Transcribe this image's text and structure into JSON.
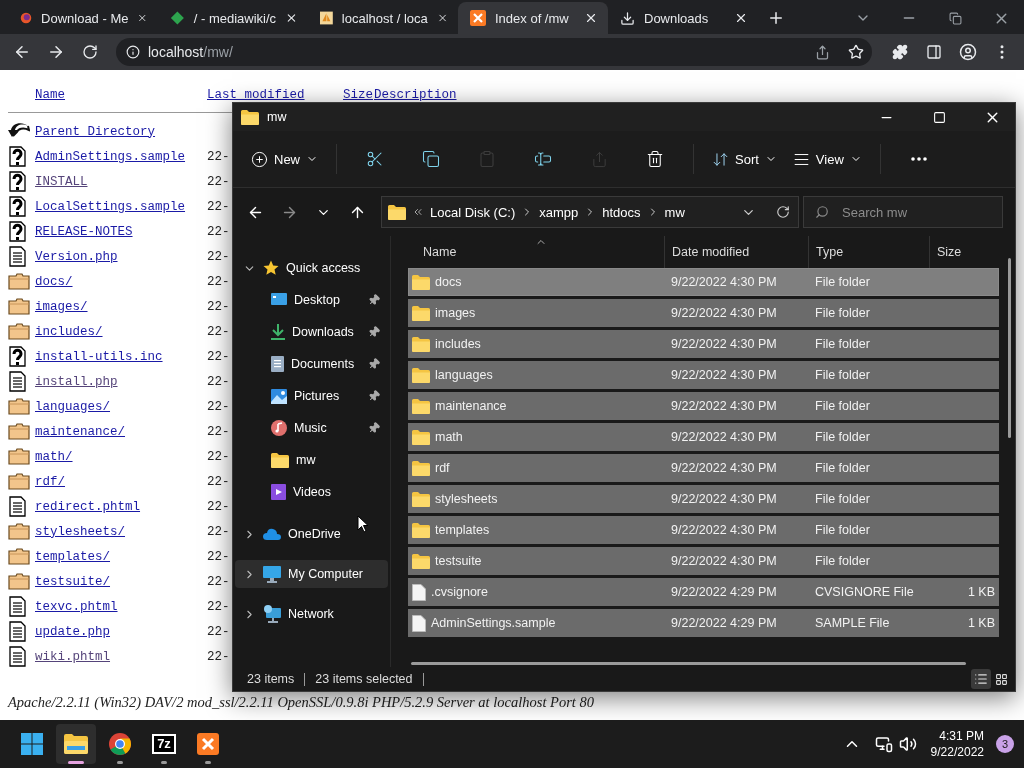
{
  "browser": {
    "tabs": [
      {
        "title": "Download - Me",
        "selected": false
      },
      {
        "title": "/ - mediawiki/c",
        "selected": false
      },
      {
        "title": "localhost / loca",
        "selected": false
      },
      {
        "title": "Index of /mw",
        "selected": true
      },
      {
        "title": "Downloads",
        "selected": false
      }
    ],
    "address": {
      "host": "localhost",
      "path": "/mw/"
    }
  },
  "listing": {
    "columns": [
      "Name",
      "Last modified",
      "Size",
      "Description"
    ],
    "rows": [
      {
        "kind": "parent",
        "name": "Parent Directory",
        "visited": false
      },
      {
        "kind": "unknown",
        "name": "AdminSettings.sample",
        "date": "22-",
        "visited": false
      },
      {
        "kind": "unknown",
        "name": "INSTALL",
        "date": "22-",
        "visited": true
      },
      {
        "kind": "unknown",
        "name": "LocalSettings.sample",
        "date": "22-",
        "visited": false
      },
      {
        "kind": "unknown",
        "name": "RELEASE-NOTES",
        "date": "22-",
        "visited": false
      },
      {
        "kind": "text",
        "name": "Version.php",
        "date": "22-",
        "visited": false
      },
      {
        "kind": "folder",
        "name": "docs/",
        "date": "22-",
        "visited": false
      },
      {
        "kind": "folder",
        "name": "images/",
        "date": "22-",
        "visited": false
      },
      {
        "kind": "folder",
        "name": "includes/",
        "date": "22-",
        "visited": false
      },
      {
        "kind": "unknown",
        "name": "install-utils.inc",
        "date": "22-",
        "visited": false
      },
      {
        "kind": "text",
        "name": "install.php",
        "date": "22-",
        "visited": true
      },
      {
        "kind": "folder",
        "name": "languages/",
        "date": "22-",
        "visited": false
      },
      {
        "kind": "folder",
        "name": "maintenance/",
        "date": "22-",
        "visited": false
      },
      {
        "kind": "folder",
        "name": "math/",
        "date": "22-",
        "visited": false
      },
      {
        "kind": "folder",
        "name": "rdf/",
        "date": "22-",
        "visited": false
      },
      {
        "kind": "text",
        "name": "redirect.phtml",
        "date": "22-",
        "visited": false
      },
      {
        "kind": "folder",
        "name": "stylesheets/",
        "date": "22-",
        "visited": false
      },
      {
        "kind": "folder",
        "name": "templates/",
        "date": "22-",
        "visited": false
      },
      {
        "kind": "folder",
        "name": "testsuite/",
        "date": "22-",
        "visited": false
      },
      {
        "kind": "text",
        "name": "texvc.phtml",
        "date": "22-",
        "visited": false
      },
      {
        "kind": "text",
        "name": "update.php",
        "date": "22-",
        "visited": false
      },
      {
        "kind": "text",
        "name": "wiki.phtml",
        "date": "22-",
        "visited": true
      }
    ],
    "footer": "Apache/2.2.11 (Win32) DAV/2 mod_ssl/2.2.11 OpenSSL/0.9.8i PHP/5.2.9 Server at localhost Port 80"
  },
  "explorer": {
    "title": "mw",
    "commands": [
      {
        "kind": "new",
        "label": "New",
        "disabled": false
      },
      {
        "kind": "cut",
        "disabled": false
      },
      {
        "kind": "copy",
        "disabled": false
      },
      {
        "kind": "paste",
        "disabled": true
      },
      {
        "kind": "rename",
        "disabled": false
      },
      {
        "kind": "share",
        "disabled": true
      },
      {
        "kind": "delete",
        "disabled": false
      },
      {
        "kind": "sort",
        "label": "Sort",
        "disabled": false
      },
      {
        "kind": "view",
        "label": "View",
        "disabled": false
      },
      {
        "kind": "more",
        "disabled": false
      }
    ],
    "breadcrumb": [
      "Local Disk (C:)",
      "xampp",
      "htdocs",
      "mw"
    ],
    "search": {
      "placeholder": "Search mw"
    },
    "nav": [
      {
        "label": "Quick access",
        "expanded": true,
        "selected": false,
        "children": [
          {
            "label": "Desktop",
            "pinned": true,
            "selected": false
          },
          {
            "label": "Downloads",
            "pinned": true,
            "selected": false
          },
          {
            "label": "Documents",
            "pinned": true,
            "selected": false
          },
          {
            "label": "Pictures",
            "pinned": true,
            "selected": false
          },
          {
            "label": "Music",
            "pinned": true,
            "selected": false
          },
          {
            "label": "mw",
            "pinned": false,
            "selected": false
          },
          {
            "label": "Videos",
            "pinned": false,
            "selected": false
          }
        ]
      },
      {
        "label": "OneDrive",
        "expanded": false,
        "selected": false
      },
      {
        "label": "My Computer",
        "expanded": false,
        "selected": true
      },
      {
        "label": "Network",
        "expanded": false,
        "selected": false
      }
    ],
    "columns": [
      "Name",
      "Date modified",
      "Type",
      "Size"
    ],
    "files": [
      {
        "kind": "folder",
        "name": "docs",
        "date": "9/22/2022 4:30 PM",
        "type": "File folder",
        "selected": true,
        "focused": true
      },
      {
        "kind": "folder",
        "name": "images",
        "date": "9/22/2022 4:30 PM",
        "type": "File folder",
        "selected": true,
        "focused": false
      },
      {
        "kind": "folder",
        "name": "includes",
        "date": "9/22/2022 4:30 PM",
        "type": "File folder",
        "selected": true,
        "focused": false
      },
      {
        "kind": "folder",
        "name": "languages",
        "date": "9/22/2022 4:30 PM",
        "type": "File folder",
        "selected": true,
        "focused": false
      },
      {
        "kind": "folder",
        "name": "maintenance",
        "date": "9/22/2022 4:30 PM",
        "type": "File folder",
        "selected": true,
        "focused": false
      },
      {
        "kind": "folder",
        "name": "math",
        "date": "9/22/2022 4:30 PM",
        "type": "File folder",
        "selected": true,
        "focused": false
      },
      {
        "kind": "folder",
        "name": "rdf",
        "date": "9/22/2022 4:30 PM",
        "type": "File folder",
        "selected": true,
        "focused": false
      },
      {
        "kind": "folder",
        "name": "stylesheets",
        "date": "9/22/2022 4:30 PM",
        "type": "File folder",
        "selected": true,
        "focused": false
      },
      {
        "kind": "folder",
        "name": "templates",
        "date": "9/22/2022 4:30 PM",
        "type": "File folder",
        "selected": true,
        "focused": false
      },
      {
        "kind": "folder",
        "name": "testsuite",
        "date": "9/22/2022 4:30 PM",
        "type": "File folder",
        "selected": true,
        "focused": false
      },
      {
        "kind": "file",
        "name": ".cvsignore",
        "date": "9/22/2022 4:29 PM",
        "type": "CVSIGNORE File",
        "size": "1 KB",
        "selected": true,
        "focused": false
      },
      {
        "kind": "file",
        "name": "AdminSettings.sample",
        "date": "9/22/2022 4:29 PM",
        "type": "SAMPLE File",
        "size": "1 KB",
        "selected": true,
        "focused": false
      }
    ],
    "status": {
      "count": "23 items",
      "selection": "23 items selected"
    }
  },
  "taskbar": {
    "apps": [
      {
        "active": false,
        "running": false
      },
      {
        "active": true,
        "running": true
      },
      {
        "active": false,
        "running": true
      },
      {
        "label": "7z",
        "active": false,
        "running": true
      },
      {
        "active": false,
        "running": true
      }
    ],
    "time": "4:31 PM",
    "date": "9/22/2022",
    "notifications": "3"
  }
}
